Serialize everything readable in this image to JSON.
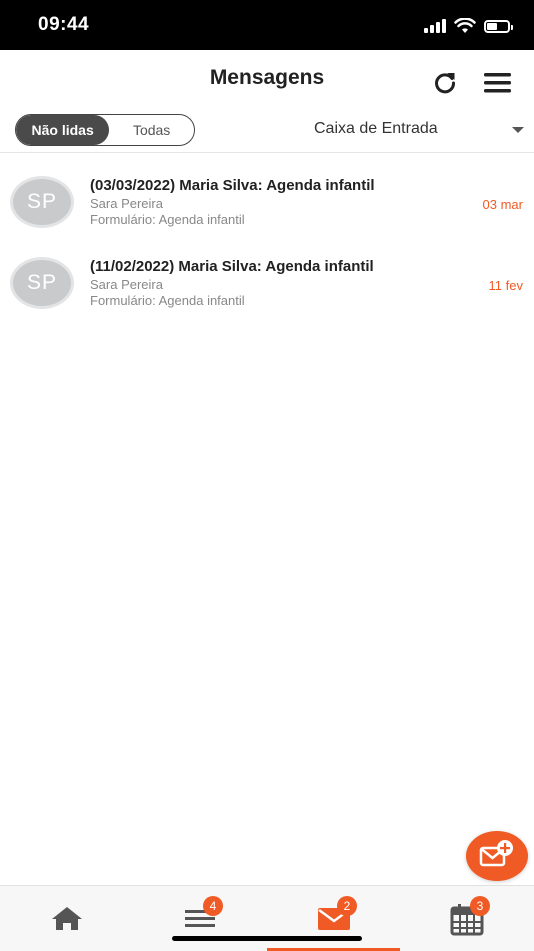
{
  "status_bar": {
    "time": "09:44"
  },
  "header": {
    "title": "Mensagens",
    "refresh_icon": "refresh-icon",
    "menu_icon": "hamburger-menu-icon"
  },
  "filters": {
    "segments": [
      "Não lidas",
      "Todas"
    ],
    "selected": "Não lidas",
    "folder": "Caixa de Entrada"
  },
  "messages": [
    {
      "avatar": "SP",
      "subject": "(03/03/2022) Maria Silva: Agenda infantil",
      "sender": "Sara Pereira",
      "form": "Formulário: Agenda infantil",
      "date": "03 mar"
    },
    {
      "avatar": "SP",
      "subject": "(11/02/2022) Maria Silva: Agenda infantil",
      "sender": "Sara Pereira",
      "form": "Formulário: Agenda infantil",
      "date": "11 fev"
    }
  ],
  "fab": {
    "icon": "compose-message-icon"
  },
  "tabs": [
    {
      "icon": "home-icon",
      "badge": null
    },
    {
      "icon": "list-icon",
      "badge": "4"
    },
    {
      "icon": "mail-icon",
      "badge": "2",
      "active": true
    },
    {
      "icon": "calendar-icon",
      "badge": "3"
    }
  ],
  "colors": {
    "accent": "#f05a24",
    "segment_active": "#4a4a4a",
    "avatar_bg": "#c8cacc"
  }
}
